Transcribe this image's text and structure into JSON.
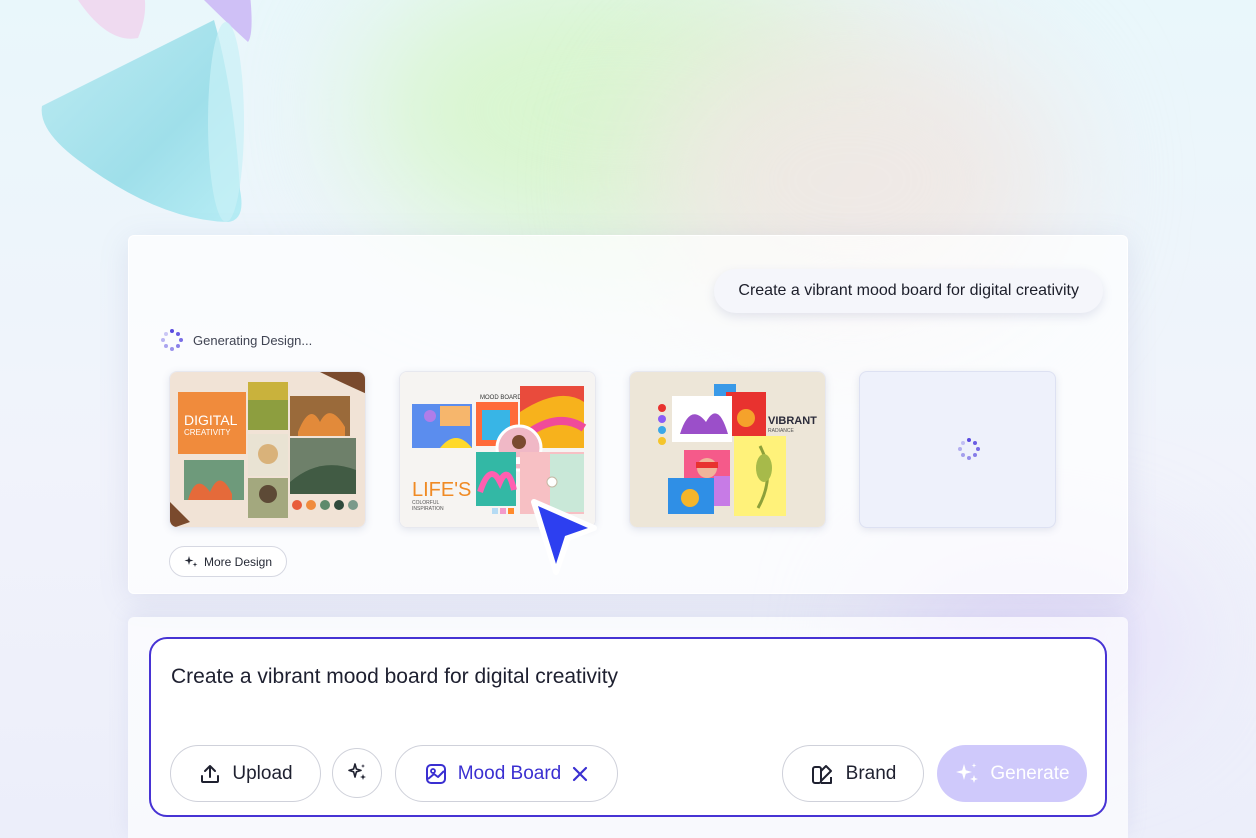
{
  "preview": {
    "prompt_bubble": "Create a vibrant mood board for digital creativity",
    "status_text": "Generating Design...",
    "more_design_label": "More Design",
    "cards": [
      {
        "title_line1": "DIGITAL",
        "title_line2": "CREATIVITY"
      },
      {
        "header": "MOOD BOARD",
        "title": "LIFE'S",
        "subtitle_line1": "COLORFUL",
        "subtitle_line2": "INSPIRATION"
      },
      {
        "title": "VIBRANT",
        "subtitle": "RADIANCE"
      },
      {
        "state": "loading"
      }
    ]
  },
  "composer": {
    "prompt_text": "Create a vibrant mood board for digital creativity",
    "upload_label": "Upload",
    "chip_label": "Mood Board",
    "brand_label": "Brand",
    "generate_label": "Generate"
  },
  "colors": {
    "accent": "#4733d4",
    "chip_text": "#3a2fd1",
    "generate_bg": "#cfc9fb"
  },
  "icons": [
    "spinner-icon",
    "sparkle-icon",
    "upload-icon",
    "magic-wand-icon",
    "mood-board-icon",
    "close-icon",
    "brand-icon",
    "cursor-arrow-icon"
  ]
}
